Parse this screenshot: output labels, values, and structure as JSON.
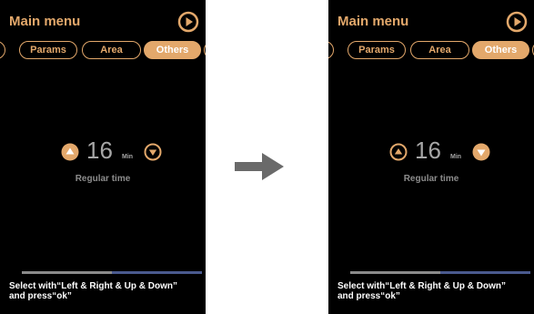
{
  "colors": {
    "accent": "#e3a86b",
    "panel_bg": "#000000",
    "value_text": "#a6a6a6",
    "progress_done": "#8a8a8a",
    "progress_rest": "#4a5a8e",
    "transition_arrow": "#6a6a6a"
  },
  "icons": {
    "header_action": "play-circle-icon",
    "increment": "triangle-up-circle-icon",
    "decrement": "triangle-down-circle-icon",
    "transition": "right-arrow-icon"
  },
  "screens": [
    {
      "header": {
        "title": "Main menu"
      },
      "tabs": [
        {
          "label": "",
          "active": false
        },
        {
          "label": "Params",
          "active": false
        },
        {
          "label": "Area",
          "active": false
        },
        {
          "label": "Others",
          "active": true
        },
        {
          "label": "",
          "active": false
        }
      ],
      "setting": {
        "value": "16",
        "unit": "Min",
        "label": "Regular time",
        "focused_arrow": "up"
      },
      "progress": {
        "fraction": 0.5
      },
      "footer": {
        "line1": "Select with“Left & Right & Up & Down”",
        "line2": "and press“ok”"
      }
    },
    {
      "header": {
        "title": "Main menu"
      },
      "tabs": [
        {
          "label": "",
          "active": false
        },
        {
          "label": "Params",
          "active": false
        },
        {
          "label": "Area",
          "active": false
        },
        {
          "label": "Others",
          "active": true
        },
        {
          "label": "",
          "active": false
        }
      ],
      "setting": {
        "value": "16",
        "unit": "Min",
        "label": "Regular time",
        "focused_arrow": "down"
      },
      "progress": {
        "fraction": 0.5
      },
      "footer": {
        "line1": "Select with“Left & Right & Up & Down”",
        "line2": "and press“ok”"
      }
    }
  ]
}
